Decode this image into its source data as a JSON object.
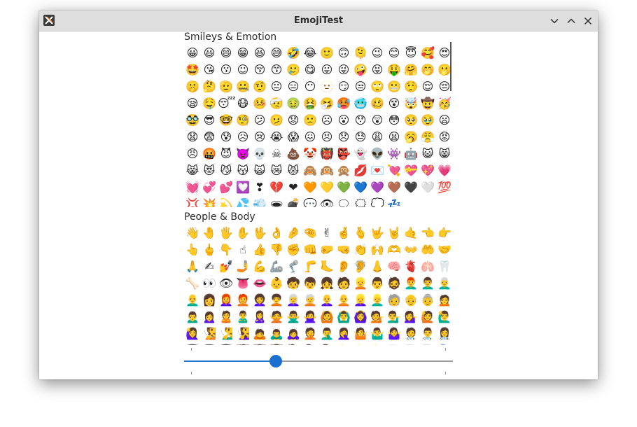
{
  "window": {
    "title": "EmojiTest"
  },
  "icons": {
    "app": "app-icon",
    "minimize": "chevron-down-icon",
    "maximize": "chevron-up-icon",
    "close": "close-icon"
  },
  "colors": {
    "accent": "#1a6fd0",
    "titlebar": "#dedede"
  },
  "categories": [
    {
      "name": "Smileys & Emotion",
      "emojis": [
        "😀",
        "😃",
        "😄",
        "😁",
        "😆",
        "😅",
        "🤣",
        "😂",
        "🙂",
        "🙃",
        "🫠",
        "😉",
        "😊",
        "😇",
        "🥰",
        "😍",
        "🤩",
        "😘",
        "😗",
        "☺",
        "😚",
        "😙",
        "🥲",
        "😋",
        "😛",
        "😜",
        "🤪",
        "😝",
        "🤑",
        "🤗",
        "🤭",
        "🫢",
        "🤫",
        "🤔",
        "🫡",
        "🤐",
        "🤨",
        "😐",
        "😑",
        "😶",
        "🫥",
        "😏",
        "😒",
        "🙄",
        "😬",
        "🤥",
        "😌",
        "😔",
        "😪",
        "🤤",
        "😴",
        "😷",
        "🤒",
        "🤕",
        "🤢",
        "🤮",
        "🤧",
        "🥵",
        "🥶",
        "🥴",
        "😵",
        "🤯",
        "🤠",
        "🥳",
        "🥸",
        "😎",
        "🤓",
        "🧐",
        "😕",
        "🫤",
        "😟",
        "🙁",
        "☹",
        "😮",
        "😯",
        "😲",
        "😳",
        "🥺",
        "🥹",
        "😦",
        "😧",
        "😨",
        "😰",
        "😥",
        "😢",
        "😭",
        "😱",
        "😖",
        "😣",
        "😞",
        "😓",
        "😩",
        "😫",
        "🥱",
        "😤",
        "😡",
        "😠",
        "🤬",
        "😈",
        "👿",
        "💀",
        "☠",
        "💩",
        "🤡",
        "👹",
        "👺",
        "👻",
        "👽",
        "👾",
        "🤖",
        "😺",
        "😸",
        "😹",
        "😻",
        "😼",
        "😽",
        "🙀",
        "😿",
        "😾",
        "🙈",
        "🙉",
        "🙊",
        "💋",
        "💌",
        "💘",
        "💝",
        "💖",
        "💗",
        "💓",
        "💞",
        "💕",
        "💟",
        "❣",
        "💔",
        "❤",
        "🧡",
        "💛",
        "💚",
        "💙",
        "💜",
        "🤎",
        "🖤",
        "🤍",
        "💯",
        "💢",
        "💥",
        "💫",
        "💦",
        "💨",
        "🕳",
        "💣",
        "💬",
        "👁",
        "🗨",
        "🗯",
        "💭",
        "💤"
      ]
    },
    {
      "name": "People & Body",
      "emojis": [
        "👋",
        "🤚",
        "🖐",
        "✋",
        "🖖",
        "👌",
        "🤌",
        "🤏",
        "✌",
        "🤞",
        "🫰",
        "🤟",
        "🤘",
        "🤙",
        "👈",
        "👉",
        "👆",
        "🖕",
        "👇",
        "☝",
        "👍",
        "👎",
        "✊",
        "👊",
        "🤛",
        "🤜",
        "👏",
        "🙌",
        "🫶",
        "👐",
        "🤲",
        "🤝",
        "🙏",
        "✍",
        "💅",
        "🤳",
        "💪",
        "🦾",
        "🦿",
        "🦵",
        "🦶",
        "👂",
        "🦻",
        "👃",
        "🧠",
        "🫀",
        "🫁",
        "🦷",
        "🦴",
        "👀",
        "👁",
        "👅",
        "👄",
        "👶",
        "🧒",
        "👦",
        "👧",
        "🧑",
        "👱",
        "👨",
        "🧔",
        "👨‍🦰",
        "👨‍🦱",
        "👨‍🦳",
        "👨‍🦲",
        "👩",
        "👩‍🦰",
        "🧑‍🦰",
        "👩‍🦱",
        "🧑‍🦱",
        "👩‍🦳",
        "🧑‍🦳",
        "👩‍🦲",
        "🧑‍🦲",
        "👱‍♀️",
        "👱‍♂️",
        "🧓",
        "👴",
        "👵",
        "🙍",
        "🙍‍♂️",
        "🙍‍♀️",
        "🙎",
        "🙎‍♂️",
        "🙎‍♀️",
        "🙅",
        "🙅‍♂️",
        "🙅‍♀️",
        "🙆",
        "🙆‍♂️",
        "🙆‍♀️",
        "💁",
        "💁‍♂️",
        "💁‍♀️",
        "🙋",
        "🙋‍♂️",
        "🙋‍♀️",
        "🧏",
        "🧏‍♂️",
        "🧏‍♀️",
        "🙇",
        "🙇‍♂️",
        "🙇‍♀️",
        "🤦",
        "🤦‍♂️",
        "🤦‍♀️",
        "🤷",
        "🤷‍♂️",
        "🤷‍♀️",
        "🧑‍⚕️",
        "👨‍⚕️",
        "👩‍⚕️",
        "🧑‍🎓",
        "👨‍🎓",
        "👩‍🎓",
        "🧑‍🏫",
        "👨‍🏫",
        "👩‍🏫",
        "🧑‍⚖️",
        "👨‍⚖️",
        "👩‍⚖️",
        "🧑‍🌾",
        "👨‍🌾",
        "👩‍🌾",
        "🧑‍🍳",
        "👨‍🍳",
        "👩‍🍳",
        "🧑‍🔧",
        "👨‍🔧",
        "👩‍🔧",
        "🧑‍🏭",
        "👨‍🏭",
        "👩‍🏭",
        "🧑‍💼",
        "👨‍💼",
        "👩‍💼"
      ]
    }
  ],
  "slider": {
    "value": 0.34
  }
}
